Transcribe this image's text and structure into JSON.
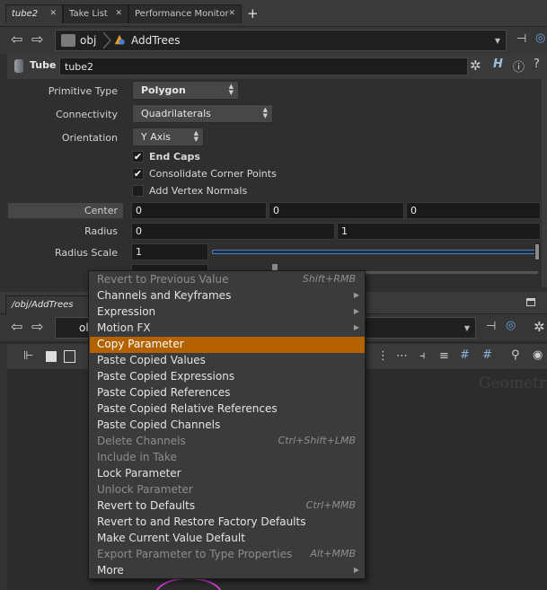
{
  "tabs_top": [
    {
      "label": "tube2"
    },
    {
      "label": "Take List"
    },
    {
      "label": "Performance Monitor"
    }
  ],
  "path_top": {
    "root": "obj",
    "node": "AddTrees"
  },
  "param_header": {
    "node_type": "Tube",
    "node_name": "tube2"
  },
  "params": {
    "primitive_type": {
      "label": "Primitive Type",
      "value": "Polygon"
    },
    "connectivity": {
      "label": "Connectivity",
      "value": "Quadrilaterals"
    },
    "orientation": {
      "label": "Orientation",
      "value": "Y Axis"
    },
    "end_caps": {
      "label": "End Caps",
      "checked": true
    },
    "consolidate": {
      "label": "Consolidate Corner Points",
      "checked": true
    },
    "vertex_normals": {
      "label": "Add Vertex Normals",
      "checked": false
    },
    "center": {
      "label": "Center",
      "values": [
        "0",
        "0",
        "0"
      ]
    },
    "radius": {
      "label": "Radius",
      "values": [
        "0",
        "1"
      ]
    },
    "radius_scale": {
      "label": "Radius Scale",
      "value": "1",
      "slider_fraction": 1.0
    }
  },
  "tabs_lower": [
    {
      "label": "/obj/AddTrees"
    }
  ],
  "path_lower": {
    "root": "ol"
  },
  "network_watermark": "Geometry",
  "context_menu": [
    {
      "label": "Revert to Previous Value",
      "shortcut": "Shift+RMB",
      "disabled": true
    },
    {
      "label": "Channels and Keyframes",
      "submenu": true
    },
    {
      "label": "Expression",
      "submenu": true
    },
    {
      "label": "Motion FX",
      "submenu": true
    },
    {
      "label": "Copy Parameter",
      "highlighted": true
    },
    {
      "label": "Paste Copied Values"
    },
    {
      "label": "Paste Copied Expressions"
    },
    {
      "label": "Paste Copied References"
    },
    {
      "label": "Paste Copied Relative References"
    },
    {
      "label": "Paste Copied Channels"
    },
    {
      "label": "Delete Channels",
      "shortcut": "Ctrl+Shift+LMB",
      "disabled": true
    },
    {
      "label": "Include in Take",
      "disabled": true
    },
    {
      "label": "Lock Parameter"
    },
    {
      "label": "Unlock Parameter",
      "disabled": true
    },
    {
      "label": "Revert to Defaults",
      "shortcut": "Ctrl+MMB"
    },
    {
      "label": "Revert to and Restore Factory Defaults"
    },
    {
      "label": "Make Current Value Default"
    },
    {
      "label": "Export Parameter to Type Properties",
      "shortcut": "Alt+MMB",
      "disabled": true
    },
    {
      "label": "More",
      "submenu": true
    }
  ],
  "colors": {
    "accent": "#b46200",
    "node_ring": "#d63fd6"
  }
}
